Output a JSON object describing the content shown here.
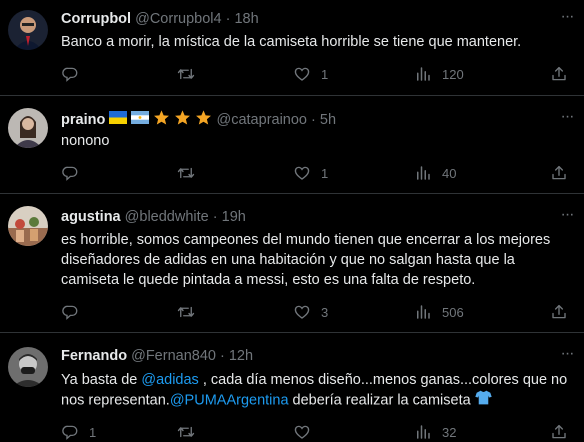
{
  "colors": {
    "background": "#000000",
    "text": "#e7e9ea",
    "muted": "#71767b",
    "link": "#1d9bf0",
    "divider": "#2f3336"
  },
  "tweets": [
    {
      "name": "Corrupbol",
      "handle": "@Corrupbol4",
      "sep": "·",
      "time": "18h",
      "text": "Banco a morir,  la mística de la camiseta horrible se tiene que mantener.",
      "likes": "1",
      "views": "120"
    },
    {
      "name": "praino",
      "handle": "@cataprainoo",
      "sep": "·",
      "time": "5h",
      "text": "nonono",
      "likes": "1",
      "views": "40"
    },
    {
      "name": "agustina",
      "handle": "@bleddwhite",
      "sep": "·",
      "time": "19h",
      "text": "es horrible, somos campeones del mundo tienen que encerrar a los mejores diseñadores de adidas en una habitación y que no salgan hasta que la camiseta le quede pintada a messi, esto es una falta de respeto.",
      "likes": "3",
      "views": "506"
    },
    {
      "name": "Fernando",
      "handle": "@Fernan840",
      "sep": "·",
      "time": "12h",
      "text_part1": "Ya basta de ",
      "mention1": "@adidas",
      "text_part2": " , cada día menos diseño...menos ganas...colores que no nos representan.",
      "mention2": "@PUMAArgentina",
      "text_part3": " debería realizar la camiseta ",
      "replies": "1",
      "views": "32"
    }
  ],
  "icons": {
    "reply": "reply-icon",
    "retweet": "retweet-icon",
    "like": "heart-icon",
    "views": "views-icon",
    "share": "share-icon",
    "more": "more-icon"
  }
}
